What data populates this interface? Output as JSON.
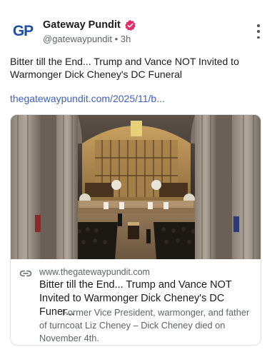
{
  "post": {
    "author": {
      "avatar_text": "GP",
      "display_name": "Gateway Pundit",
      "handle": "@gatewaypundit",
      "separator": "•",
      "time_ago": "3h",
      "verified_icon": "verified-badge-icon",
      "verified_color": "#e0306c"
    },
    "more_icon": "more-vertical-icon",
    "text": "Bitter till the End... Trump and Vance NOT Invited to Warmonger Dick Cheney's DC Funeral",
    "link_text": "thegatewaypundit.com/2025/11/b...",
    "link_color": "#3d5fc7",
    "card": {
      "image_desc_icon": "cathedral-funeral-photo",
      "link_icon": "link-icon",
      "domain": "www.thegatewaypundit.com",
      "title": "Bitter till the End... Trump and Vance NOT Invited to Warmonger Dick Cheney's DC Funer...",
      "description": "Former Vice President, warmonger, and father of turncoat Liz Cheney – Dick Cheney died on November 4th."
    }
  }
}
